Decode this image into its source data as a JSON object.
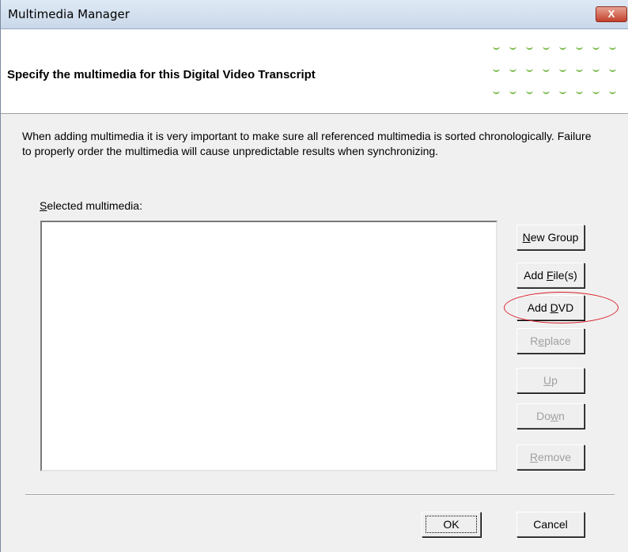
{
  "window": {
    "title": "Multimedia Manager",
    "close_label": "X"
  },
  "header": {
    "title": "Specify the multimedia for this Digital Video Transcript"
  },
  "instructions": "When adding multimedia it is very important to make sure all referenced multimedia is sorted chronologically.  Failure to properly order the multimedia will cause unpredictable results when synchronizing.",
  "selected_label": {
    "before": "",
    "mnemonic": "S",
    "after": "elected multimedia:"
  },
  "multimedia_list": {
    "items": []
  },
  "buttons": {
    "new_group": {
      "before": "",
      "mnemonic": "N",
      "after": "ew Group",
      "enabled": true
    },
    "add_files": {
      "before": "Add ",
      "mnemonic": "F",
      "after": "ile(s)",
      "enabled": true
    },
    "add_dvd": {
      "before": "Add ",
      "mnemonic": "D",
      "after": "VD",
      "enabled": true
    },
    "replace": {
      "before": "R",
      "mnemonic": "e",
      "after": "place",
      "enabled": false
    },
    "up": {
      "before": "",
      "mnemonic": "U",
      "after": "p",
      "enabled": false
    },
    "down": {
      "before": "Do",
      "mnemonic": "w",
      "after": "n",
      "enabled": false
    },
    "remove": {
      "before": "",
      "mnemonic": "R",
      "after": "emove",
      "enabled": false
    },
    "ok": {
      "label": "OK"
    },
    "cancel": {
      "label": "Cancel"
    }
  },
  "colors": {
    "dots": "#7aba4c",
    "highlight": "#d8202a"
  }
}
